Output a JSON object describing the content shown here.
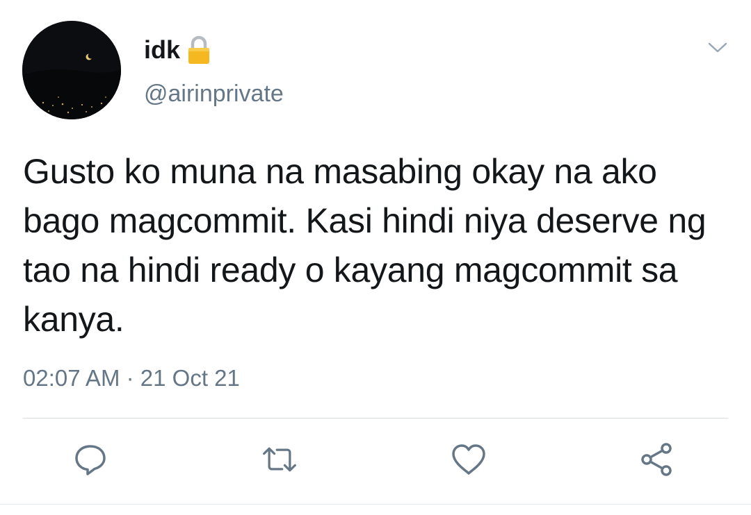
{
  "tweet": {
    "display_name": "idk",
    "handle": "@airinprivate",
    "text": "Gusto ko muna na masabing okay na ako bago magcommit. Kasi hindi niya deserve ng tao na hindi ready o kayang magcommit sa kanya.",
    "time": "02:07 AM",
    "separator": "·",
    "date": "21 Oct 21"
  },
  "icons": {
    "lock": "lock-icon",
    "menu": "chevron-down-icon",
    "reply": "reply-icon",
    "retweet": "retweet-icon",
    "like": "heart-icon",
    "share": "share-icon"
  },
  "colors": {
    "text": "#14171a",
    "secondary": "#657786",
    "icon": "#657786",
    "divider": "#d8dde1",
    "lock_gold": "#f5b820"
  }
}
